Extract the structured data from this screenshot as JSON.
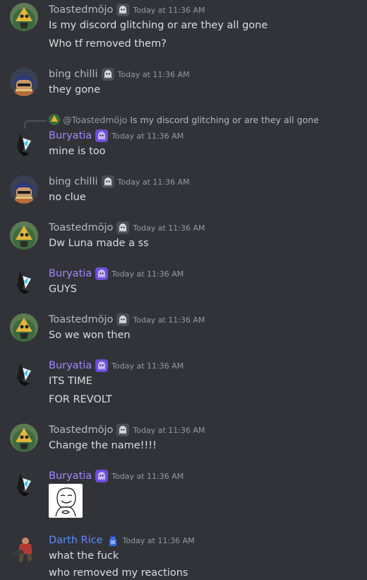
{
  "colors": {
    "background": "#313338",
    "toasted": "#b5bac1",
    "bing": "#b5bac1",
    "buryatia": "#a586ff",
    "darth": "#5b8dff",
    "timestamp": "#949ba4"
  },
  "messages": [
    {
      "author": "Toastedmöjo",
      "badge": "ghost-badge-icon",
      "time": "Today at 11:36 AM",
      "lines": [
        "Is my discord glitching or are they all gone",
        "Who tf removed them?"
      ]
    },
    {
      "author": "bing chilli",
      "badge": "ghost-badge-icon",
      "time": "Today at 11:36 AM",
      "lines": [
        "they gone"
      ]
    },
    {
      "author": "Buryatia",
      "badge": "purple-ghost-badge-icon",
      "time": "Today at 11:36 AM",
      "reply": {
        "name": "@Toastedmöjo",
        "text": "Is my discord glitching or are they all gone"
      },
      "lines": [
        "mine is too"
      ]
    },
    {
      "author": "bing chilli",
      "badge": "ghost-badge-icon",
      "time": "Today at 11:36 AM",
      "lines": [
        "no clue"
      ]
    },
    {
      "author": "Toastedmöjo",
      "badge": "ghost-badge-icon",
      "time": "Today at 11:36 AM",
      "lines": [
        "Dw Luna made a ss"
      ]
    },
    {
      "author": "Buryatia",
      "badge": "purple-ghost-badge-icon",
      "time": "Today at 11:36 AM",
      "lines": [
        "GUYS"
      ]
    },
    {
      "author": "Toastedmöjo",
      "badge": "ghost-badge-icon",
      "time": "Today at 11:36 AM",
      "lines": [
        "So we won then"
      ]
    },
    {
      "author": "Buryatia",
      "badge": "purple-ghost-badge-icon",
      "time": "Today at 11:36 AM",
      "lines": [
        "ITS TIME",
        "FOR REVOLT"
      ]
    },
    {
      "author": "Toastedmöjo",
      "badge": "ghost-badge-icon",
      "time": "Today at 11:36 AM",
      "lines": [
        "Change the name!!!!"
      ]
    },
    {
      "author": "Buryatia",
      "badge": "purple-ghost-badge-icon",
      "time": "Today at 11:36 AM",
      "lines": [],
      "sticker": "troll-face-sticker"
    },
    {
      "author": "Darth Rice",
      "badge": "blue-potion-badge-icon",
      "time": "Today at 11:36 AM",
      "lines": [
        "what the fuck",
        "who removed my reactions"
      ]
    }
  ]
}
